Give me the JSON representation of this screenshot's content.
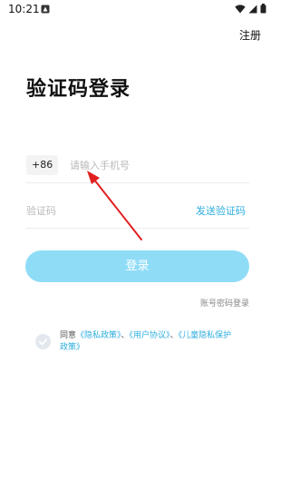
{
  "status_bar": {
    "time": "10:21"
  },
  "header": {
    "register_label": "注册"
  },
  "page": {
    "title": "验证码登录"
  },
  "form": {
    "country_code": "+86",
    "phone_placeholder": "请输入手机号",
    "code_placeholder": "验证码",
    "send_code_label": "发送验证码",
    "login_label": "登录",
    "password_login_label": "账号密码登录"
  },
  "agreement": {
    "prefix": "同意",
    "privacy_policy": "《隐私政策》",
    "sep1": "、",
    "user_agreement": "《用户协议》",
    "sep2": "、",
    "children_policy": "《儿童隐私保护政策》"
  },
  "colors": {
    "accent": "#2eaedf",
    "button_bg": "#8fdcf7",
    "annotation_arrow": "#e02020"
  }
}
